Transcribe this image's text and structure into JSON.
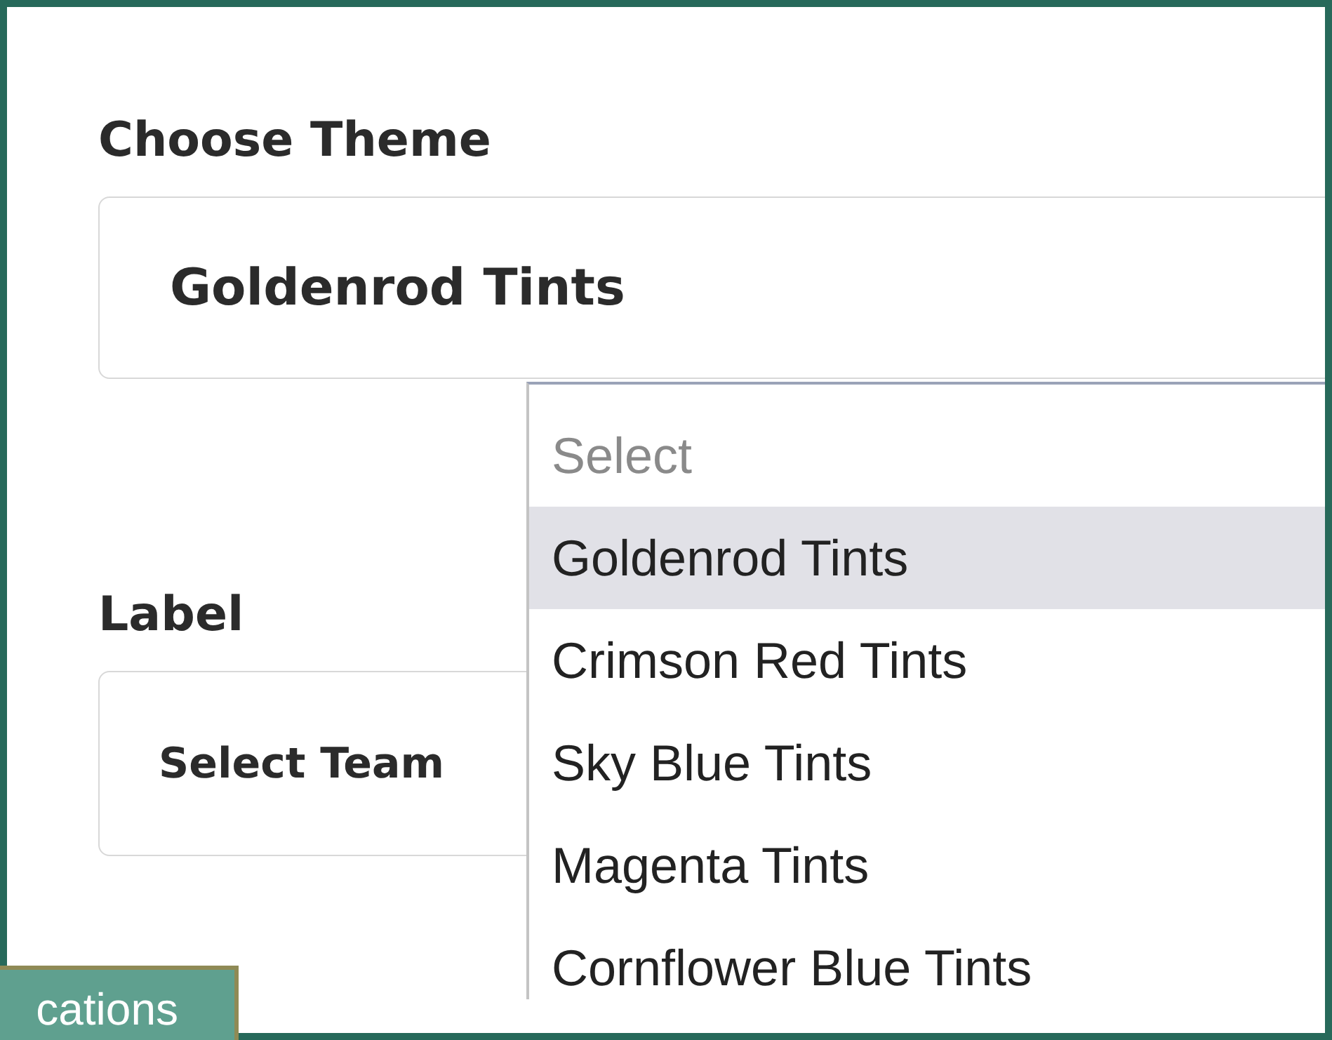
{
  "theme_field": {
    "label": "Choose Theme",
    "value": "Goldenrod Tints"
  },
  "label_field": {
    "label": "Label",
    "value": "Select Team"
  },
  "dropdown": {
    "options": [
      {
        "text": "Select",
        "kind": "placeholder",
        "selected": false
      },
      {
        "text": "Goldenrod Tints",
        "kind": "option",
        "selected": true
      },
      {
        "text": "Crimson Red Tints",
        "kind": "option",
        "selected": false
      },
      {
        "text": "Sky Blue Tints",
        "kind": "option",
        "selected": false
      },
      {
        "text": "Magenta Tints",
        "kind": "option",
        "selected": false
      },
      {
        "text": "Cornflower Blue Tints",
        "kind": "option",
        "selected": false
      }
    ]
  },
  "tag": {
    "text": "cations"
  }
}
